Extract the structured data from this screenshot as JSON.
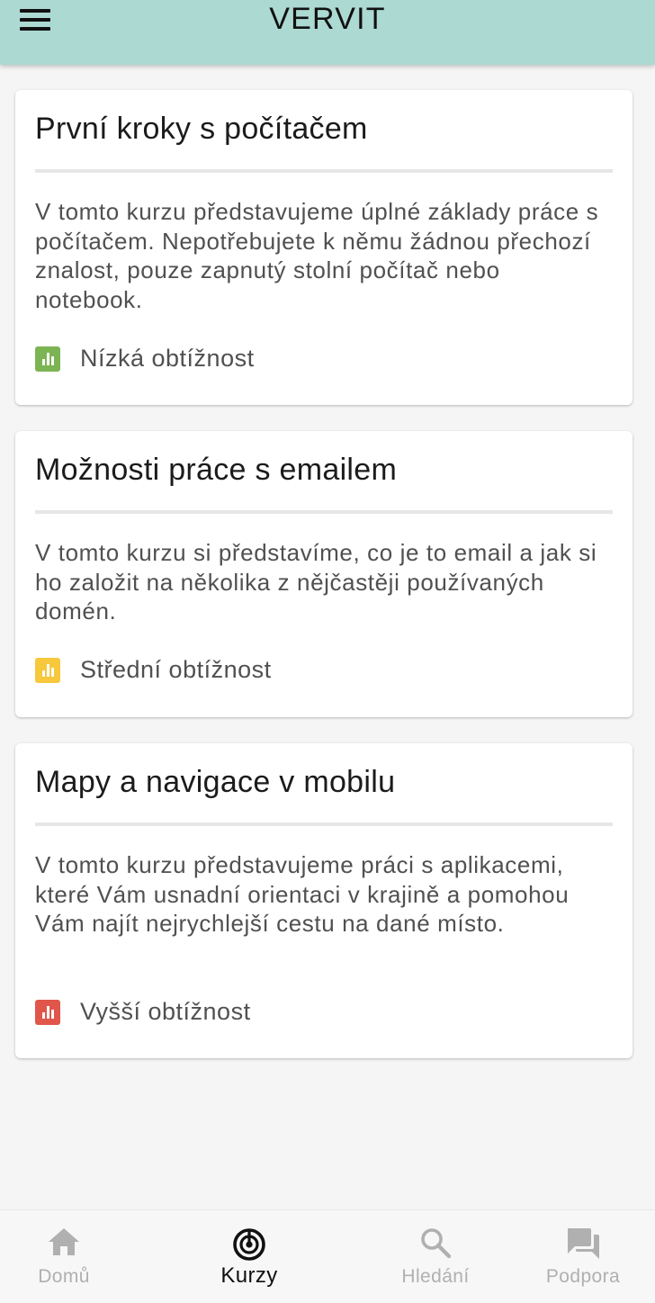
{
  "app": {
    "title": "VERVIT"
  },
  "courses": [
    {
      "title": "První kroky s počítačem",
      "description": "V tomto kurzu představujeme úplné základy práce s počítačem. Nepotřebujete k němu žádnou přechozí znalost, pouze zapnutý stolní počítač nebo notebook.",
      "difficulty": "Nízká obtížnost",
      "difficulty_color": "#7cb454"
    },
    {
      "title": "Možnosti práce s emailem",
      "description": "V tomto kurzu si představíme, co je to email a jak si ho založit na několika z nějčastěji používaných domén.",
      "difficulty": "Střední obtížnost",
      "difficulty_color": "#f7c73c"
    },
    {
      "title": "Mapy a navigace v mobilu",
      "description": "V tomto kurzu představujeme práci s aplikacemi, které Vám usnadní orientaci v krajině a pomohou Vám najít nejrychlejší cestu na dané místo.",
      "difficulty": "Vyšší obtížnost",
      "difficulty_color": "#e0564a"
    }
  ],
  "bottom_nav": {
    "items": [
      {
        "label": "Domů",
        "icon": "home-icon",
        "active": false
      },
      {
        "label": "Kurzy",
        "icon": "courses-icon",
        "active": true
      },
      {
        "label": "Hledání",
        "icon": "search-icon",
        "active": false
      },
      {
        "label": "Podpora",
        "icon": "forum-icon",
        "active": false
      }
    ],
    "active_color": "#111111",
    "inactive_color": "#b0b0b0"
  }
}
